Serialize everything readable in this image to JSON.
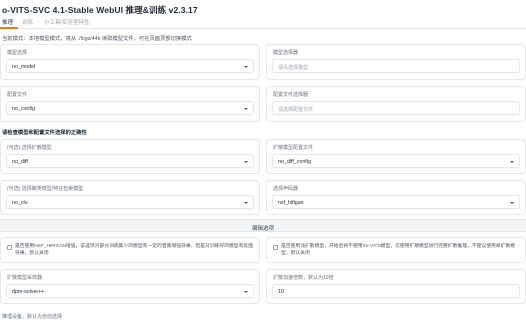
{
  "app": {
    "title": "o-VITS-SVC 4.1-Stable WebUI 推理&训练 v2.3.17"
  },
  "tabs": [
    {
      "label": "推理"
    },
    {
      "label": "训练"
    },
    {
      "label": "小工具/实验室特性"
    }
  ],
  "mode_text": "当前模式：本地模型模式，将从 ./logs/44k 读取模型文件，可在页面顶部切换模式",
  "section_label": "请检查模型和配置文件选择的正确性",
  "cards": {
    "model_select": {
      "label": "模型选择",
      "value": "no_model"
    },
    "model_uploader": {
      "label": "模型选择器",
      "placeholder": "请先选择模型"
    },
    "config_file": {
      "label": "配置文件",
      "value": "no_config"
    },
    "config_uploader": {
      "label": "配置文件选择器",
      "placeholder": "请选择配置文件"
    },
    "diff_model": {
      "label": "(可选) 选择扩散模型",
      "value": "no_diff"
    },
    "diff_config": {
      "label": "扩散模型配置文件",
      "value": "no_diff_config"
    },
    "cluster_model": {
      "label": "(可选) 选择聚类模型/特征检索模型",
      "value": "no_clu"
    },
    "vocoder": {
      "label": "选择声码器",
      "value": "nsf_hifigan"
    },
    "diff_sampler": {
      "label": "扩散模型采样器",
      "value": "dpm-solver++"
    },
    "diff_speedup": {
      "label": "扩散加速倍数，默认为10倍",
      "value": "10"
    }
  },
  "advanced": {
    "label": "编辑选项"
  },
  "checkboxes": {
    "enhance": {
      "label": "是否使用NSF_HIFIGAN增强，该选项对部分训练集少的模型有一定的音质增强效果，但是对训练好的模型有反面效果，默认关闭",
      "checked": false
    },
    "shallow_diff": {
      "label": "是否使用浅扩散模型，开始后将不使用So-VITS模型，仅使用扩散模型进行完整扩散推理，不建议使用单扩散模型，默认关闭",
      "checked": false
    }
  },
  "bottom_label": "推理设备，默认为自动选择"
}
